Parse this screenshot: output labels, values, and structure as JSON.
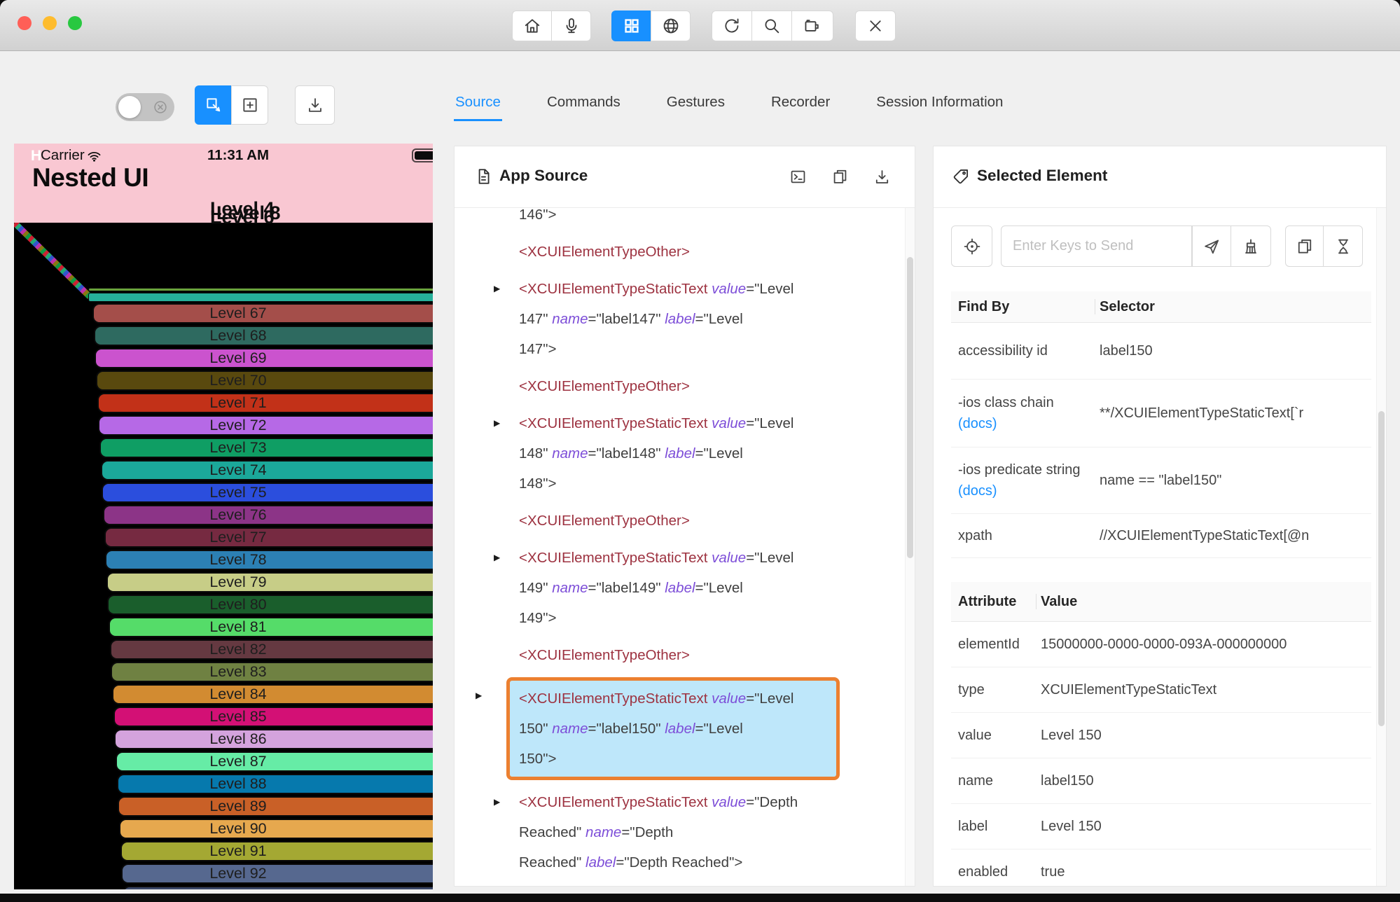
{
  "window": {
    "controls": [
      "close",
      "minimize",
      "zoom"
    ]
  },
  "titlebar": {
    "icons": [
      "home",
      "microphone",
      "app-grid",
      "globe",
      "refresh",
      "search",
      "video-camera",
      "close"
    ]
  },
  "inspector_bar": {
    "icons": [
      "selection-toggle",
      "select-element",
      "tap-by-coordinates",
      "download-screenshot"
    ],
    "tabs": [
      {
        "label": "Source",
        "active": true
      },
      {
        "label": "Commands",
        "active": false
      },
      {
        "label": "Gestures",
        "active": false
      },
      {
        "label": "Recorder",
        "active": false
      },
      {
        "label": "Session Information",
        "active": false
      }
    ]
  },
  "phone": {
    "hidden_text": "H",
    "carrier": "Carrier",
    "time": "11:31 AM",
    "app_title": "Nested UI",
    "overlap_labels": [
      "Level 4",
      "Level 8",
      "Level 6"
    ],
    "slivers": [
      {
        "color": "#69a33b",
        "h": 5
      },
      {
        "color": "#26b09a",
        "h": 13
      }
    ],
    "levels": [
      {
        "label": "Level 67",
        "color": "#a44e4a"
      },
      {
        "label": "Level 68",
        "color": "#2e6a60"
      },
      {
        "label": "Level 69",
        "color": "#cb53ce"
      },
      {
        "label": "Level 70",
        "color": "#59490e"
      },
      {
        "label": "Level 71",
        "color": "#c23118"
      },
      {
        "label": "Level 72",
        "color": "#b669e6"
      },
      {
        "label": "Level 73",
        "color": "#0f9e64"
      },
      {
        "label": "Level 74",
        "color": "#1ba89a"
      },
      {
        "label": "Level 75",
        "color": "#2b4edd"
      },
      {
        "label": "Level 76",
        "color": "#8c3487"
      },
      {
        "label": "Level 77",
        "color": "#762a41"
      },
      {
        "label": "Level 78",
        "color": "#2c80b4"
      },
      {
        "label": "Level 79",
        "color": "#c7cd87"
      },
      {
        "label": "Level 80",
        "color": "#1a5e2c"
      },
      {
        "label": "Level 81",
        "color": "#55dc69"
      },
      {
        "label": "Level 82",
        "color": "#653941"
      },
      {
        "label": "Level 83",
        "color": "#6f8142"
      },
      {
        "label": "Level 84",
        "color": "#d28b31"
      },
      {
        "label": "Level 85",
        "color": "#d31075"
      },
      {
        "label": "Level 86",
        "color": "#d4a3dd"
      },
      {
        "label": "Level 87",
        "color": "#66eca6"
      },
      {
        "label": "Level 88",
        "color": "#0679ad"
      },
      {
        "label": "Level 89",
        "color": "#c96027"
      },
      {
        "label": "Level 90",
        "color": "#e6a84e"
      },
      {
        "label": "Level 91",
        "color": "#a4a833"
      },
      {
        "label": "Level 92",
        "color": "#56688f"
      }
    ],
    "partial_level_color": "#3a4767"
  },
  "source_panel": {
    "title": "App Source",
    "action_icons": [
      "terminal",
      "copy",
      "download"
    ],
    "entries": [
      {
        "arrow": false,
        "highlight": false,
        "lines": [
          [
            {
              "s": "146\">",
              "c": "plain"
            }
          ]
        ]
      },
      {
        "arrow": false,
        "highlight": false,
        "lines": [
          [
            {
              "s": "<XCUIElementTypeOther>",
              "c": "tag"
            }
          ]
        ]
      },
      {
        "arrow": true,
        "highlight": false,
        "lines": [
          [
            {
              "s": "<XCUIElementTypeStaticText ",
              "c": "tag"
            },
            {
              "s": "value",
              "c": "attr"
            },
            {
              "s": "=\"Level",
              "c": "plain"
            }
          ],
          [
            {
              "s": "147\" ",
              "c": "plain"
            },
            {
              "s": "name",
              "c": "attr"
            },
            {
              "s": "=\"label147\" ",
              "c": "plain"
            },
            {
              "s": "label",
              "c": "attr"
            },
            {
              "s": "=\"Level",
              "c": "plain"
            }
          ],
          [
            {
              "s": "147\">",
              "c": "plain"
            }
          ]
        ]
      },
      {
        "arrow": false,
        "highlight": false,
        "lines": [
          [
            {
              "s": "<XCUIElementTypeOther>",
              "c": "tag"
            }
          ]
        ]
      },
      {
        "arrow": true,
        "highlight": false,
        "lines": [
          [
            {
              "s": "<XCUIElementTypeStaticText ",
              "c": "tag"
            },
            {
              "s": "value",
              "c": "attr"
            },
            {
              "s": "=\"Level",
              "c": "plain"
            }
          ],
          [
            {
              "s": "148\" ",
              "c": "plain"
            },
            {
              "s": "name",
              "c": "attr"
            },
            {
              "s": "=\"label148\" ",
              "c": "plain"
            },
            {
              "s": "label",
              "c": "attr"
            },
            {
              "s": "=\"Level",
              "c": "plain"
            }
          ],
          [
            {
              "s": "148\">",
              "c": "plain"
            }
          ]
        ]
      },
      {
        "arrow": false,
        "highlight": false,
        "lines": [
          [
            {
              "s": "<XCUIElementTypeOther>",
              "c": "tag"
            }
          ]
        ]
      },
      {
        "arrow": true,
        "highlight": false,
        "lines": [
          [
            {
              "s": "<XCUIElementTypeStaticText ",
              "c": "tag"
            },
            {
              "s": "value",
              "c": "attr"
            },
            {
              "s": "=\"Level",
              "c": "plain"
            }
          ],
          [
            {
              "s": "149\" ",
              "c": "plain"
            },
            {
              "s": "name",
              "c": "attr"
            },
            {
              "s": "=\"label149\" ",
              "c": "plain"
            },
            {
              "s": "label",
              "c": "attr"
            },
            {
              "s": "=\"Level",
              "c": "plain"
            }
          ],
          [
            {
              "s": "149\">",
              "c": "plain"
            }
          ]
        ]
      },
      {
        "arrow": false,
        "highlight": false,
        "lines": [
          [
            {
              "s": "<XCUIElementTypeOther>",
              "c": "tag"
            }
          ]
        ]
      },
      {
        "arrow": true,
        "highlight": true,
        "lines": [
          [
            {
              "s": "<XCUIElementTypeStaticText ",
              "c": "tag"
            },
            {
              "s": "value",
              "c": "attr"
            },
            {
              "s": "=\"Level",
              "c": "plain"
            }
          ],
          [
            {
              "s": "150\" ",
              "c": "plain"
            },
            {
              "s": "name",
              "c": "attr"
            },
            {
              "s": "=\"label150\" ",
              "c": "plain"
            },
            {
              "s": "label",
              "c": "attr"
            },
            {
              "s": "=\"Level",
              "c": "plain"
            }
          ],
          [
            {
              "s": "150\">",
              "c": "plain"
            }
          ]
        ]
      },
      {
        "arrow": true,
        "highlight": false,
        "lines": [
          [
            {
              "s": "<XCUIElementTypeStaticText ",
              "c": "tag"
            },
            {
              "s": "value",
              "c": "attr"
            },
            {
              "s": "=\"Depth",
              "c": "plain"
            }
          ],
          [
            {
              "s": "Reached\" ",
              "c": "plain"
            },
            {
              "s": "name",
              "c": "attr"
            },
            {
              "s": "=\"Depth",
              "c": "plain"
            }
          ],
          [
            {
              "s": "Reached\" ",
              "c": "plain"
            },
            {
              "s": "label",
              "c": "attr"
            },
            {
              "s": "=\"Depth Reached\">",
              "c": "plain"
            }
          ]
        ]
      }
    ]
  },
  "selected_panel": {
    "title": "Selected Element",
    "send_keys_placeholder": "Enter Keys to Send",
    "action_icons": [
      "locate",
      "send-keys",
      "clear",
      "copy-attributes",
      "hourglass"
    ],
    "find_by_table": {
      "headers": [
        "Find By",
        "Selector"
      ],
      "rows": [
        {
          "find": "accessibility id",
          "docs": "",
          "selector": "label150"
        },
        {
          "find": "-ios class chain",
          "docs": "(docs)",
          "selector": "**/XCUIElementTypeStaticText[`r"
        },
        {
          "find": "-ios predicate string",
          "docs": "(docs)",
          "selector": "name == \"label150\""
        },
        {
          "find": "xpath",
          "docs": "",
          "selector": "//XCUIElementTypeStaticText[@n"
        }
      ]
    },
    "attributes_table": {
      "headers": [
        "Attribute",
        "Value"
      ],
      "rows": [
        {
          "attribute": "elementId",
          "value": "15000000-0000-0000-093A-000000000"
        },
        {
          "attribute": "type",
          "value": "XCUIElementTypeStaticText"
        },
        {
          "attribute": "value",
          "value": "Level 150"
        },
        {
          "attribute": "name",
          "value": "label150"
        },
        {
          "attribute": "label",
          "value": "Level 150"
        },
        {
          "attribute": "enabled",
          "value": "true"
        }
      ]
    }
  },
  "colors": {
    "accent": "#1890ff",
    "highlight_bg": "#bee7fa",
    "highlight_border": "#ec8030",
    "xml_tag": "#9d3240",
    "xml_attr": "#7d4ed8",
    "phone_header": "#f9c7d2"
  }
}
